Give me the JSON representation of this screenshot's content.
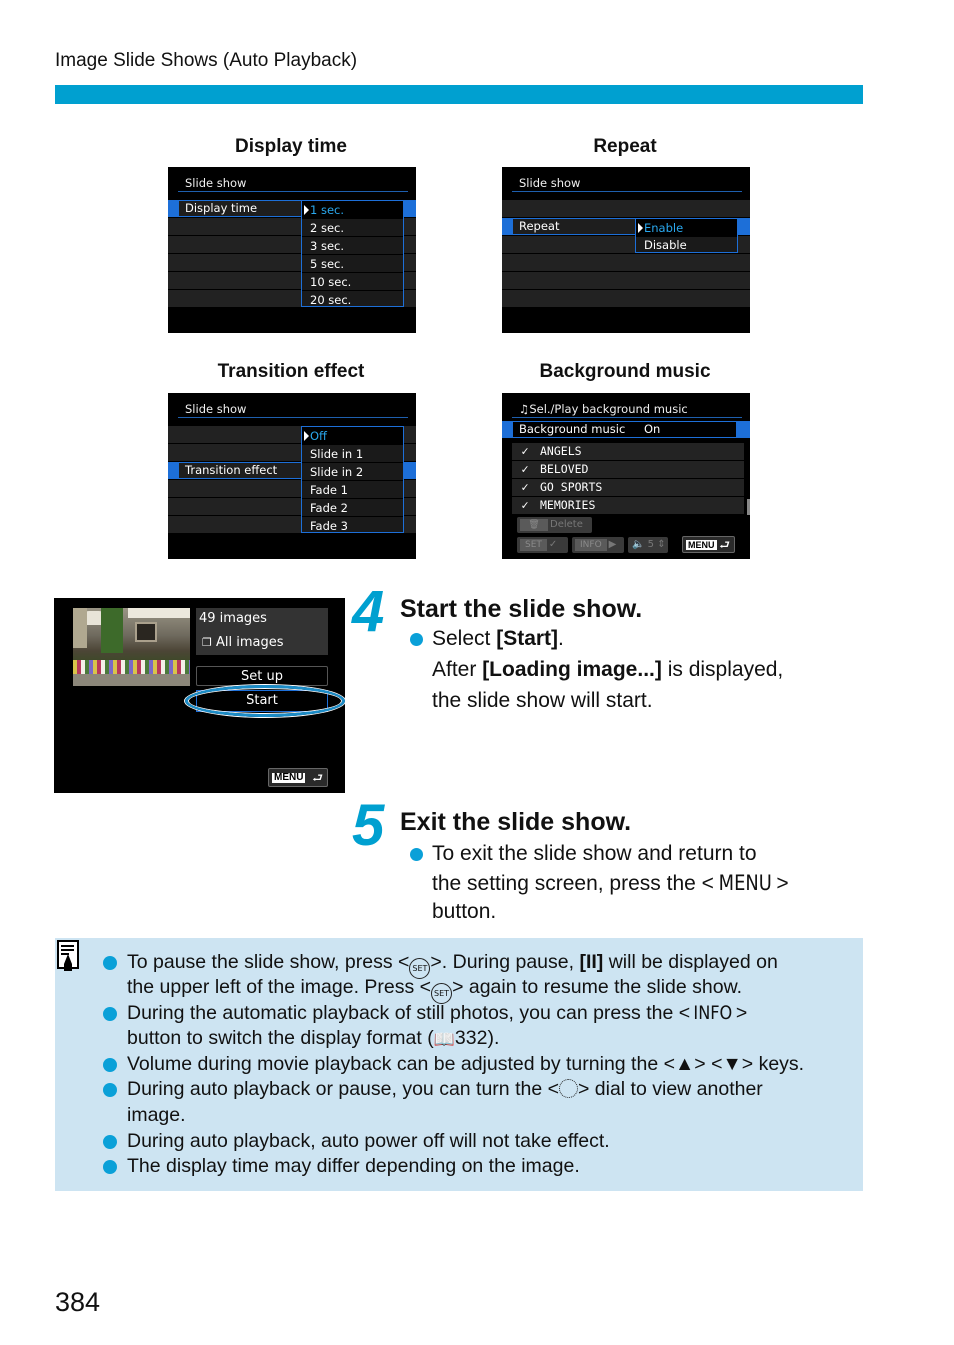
{
  "header": {
    "title": "Image Slide Shows (Auto Playback)",
    "accent_color": "#00a0d0"
  },
  "screens": {
    "display_time": {
      "caption": "Display time",
      "title": "Slide show",
      "setting_label": "Display time",
      "options": [
        "1 sec.",
        "2 sec.",
        "3 sec.",
        "5 sec.",
        "10 sec.",
        "20 sec."
      ],
      "selected": "1 sec."
    },
    "repeat": {
      "caption": "Repeat",
      "title": "Slide show",
      "setting_label": "Repeat",
      "options": [
        "Enable",
        "Disable"
      ],
      "selected": "Enable"
    },
    "transition": {
      "caption": "Transition effect",
      "title": "Slide show",
      "setting_label": "Transition effect",
      "options": [
        "Off",
        "Slide in 1",
        "Slide in 2",
        "Fade 1",
        "Fade 2",
        "Fade 3"
      ],
      "selected": "Off"
    },
    "music": {
      "caption": "Background music",
      "title": "Sel./Play background music",
      "setting_label": "Background music",
      "setting_value": "On",
      "tracks": [
        {
          "name": "ANGELS",
          "checked": true
        },
        {
          "name": "BELOVED",
          "checked": true
        },
        {
          "name": "GO SPORTS",
          "checked": true
        },
        {
          "name": "MEMORIES",
          "checked": true
        }
      ],
      "delete_label": "Delete",
      "set_label": "SET",
      "info_label": "INFO",
      "volume_label": "5",
      "menu_label": "MENU"
    }
  },
  "start_screen": {
    "count": "49 images",
    "filter": "All images",
    "setup_label": "Set up",
    "start_label": "Start",
    "menu_label": "MENU"
  },
  "steps": [
    {
      "number": "4",
      "title": "Start the slide show.",
      "line1_pre": "Select ",
      "line1_bold": "[Start]",
      "line1_post": ".",
      "line2_pre": "After ",
      "line2_bold": "[Loading image...]",
      "line2_post": " is displayed,",
      "line3": "the slide show will start."
    },
    {
      "number": "5",
      "title": "Exit the slide show.",
      "line1": "To exit the slide show and return to",
      "line2_pre": "the setting screen, press the <",
      "line2_key": "MENU",
      "line2_post": ">",
      "line3": "button."
    }
  ],
  "notes": {
    "n1a_pre": "To pause the slide show, press <",
    "set_key": "SET",
    "n1a_mid": ">. During pause, ",
    "n1a_bold": "[II]",
    "n1a_post": " will be displayed on",
    "n1b_pre": "the upper left of the image. Press <",
    "n1b_post": "> again to resume the slide show.",
    "n2a_pre": "During the automatic playback of still photos, you can press the <",
    "info_key": "INFO",
    "n2a_post": ">",
    "n2b_pre": "button to switch the display format (",
    "n2b_page": "332",
    "n2b_post": ").",
    "n3": "Volume during movie playback can be adjusted by turning the <▲> <▼> keys.",
    "n4a_pre": "During auto playback or pause, you can turn the <",
    "n4a_post": "> dial to view another",
    "n4b": "image.",
    "n5": "During auto playback, auto power off will not take effect.",
    "n6": "The display time may differ depending on the image."
  },
  "page_number": "384"
}
